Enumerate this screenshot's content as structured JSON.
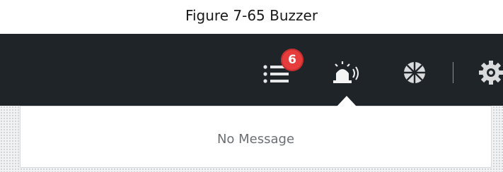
{
  "figure": {
    "caption": "Figure 7-65 Buzzer"
  },
  "topbar": {
    "background": "#1f2429",
    "icons": [
      {
        "name": "list-icon",
        "badge": "6"
      },
      {
        "name": "buzzer-icon"
      },
      {
        "name": "network-icon"
      },
      {
        "name": "gear-icon"
      }
    ],
    "badge_color": "#e63c3c"
  },
  "dropdown": {
    "empty_message": "No Message"
  }
}
